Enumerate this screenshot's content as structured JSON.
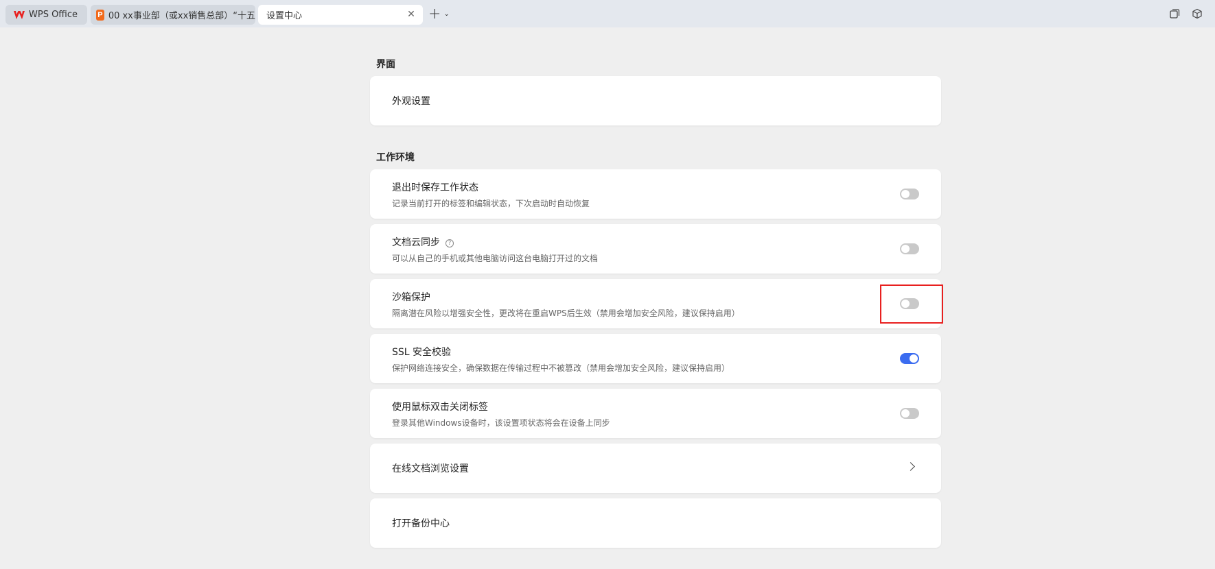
{
  "tabs": {
    "wps_label": "WPS Office",
    "doc_label": "00 xx事业部（或xx销售总部）“十五",
    "settings_label": "设置中心"
  },
  "colors": {
    "accent": "#3b6cf0",
    "highlight": "#e8201f",
    "wps_red": "#e8201f",
    "doc_orange": "#f26a1b"
  },
  "sections": {
    "interface": {
      "title": "界面",
      "appearance": "外观设置"
    },
    "work_env": {
      "title": "工作环境",
      "items": [
        {
          "title": "退出时保存工作状态",
          "desc": "记录当前打开的标签和编辑状态，下次启动时自动恢复",
          "toggle": false
        },
        {
          "title": "文档云同步",
          "desc": "可以从自己的手机或其他电脑访问这台电脑打开过的文档",
          "toggle": false,
          "help_icon": "help-circle-icon"
        },
        {
          "title": "沙箱保护",
          "desc": "隔离潜在风险以增强安全性，更改将在重启WPS后生效（禁用会增加安全风险，建议保持启用）",
          "toggle": false,
          "highlighted": true
        },
        {
          "title": "SSL 安全校验",
          "desc": "保护网络连接安全，确保数据在传输过程中不被篡改（禁用会增加安全风险，建议保持启用）",
          "toggle": true
        },
        {
          "title": "使用鼠标双击关闭标签",
          "desc": "登录其他Windows设备时，该设置项状态将会在设备上同步",
          "toggle": false
        }
      ],
      "online_browse": "在线文档浏览设置",
      "backup_center": "打开备份中心"
    }
  },
  "icons": {
    "wps_logo": "wps-logo-icon",
    "doc_icon": "presentation-icon",
    "close": "close-icon",
    "new_tab": "plus-icon",
    "new_tab_menu": "chevron-down-icon",
    "window_mode": "window-restore-icon",
    "box": "cube-icon"
  }
}
